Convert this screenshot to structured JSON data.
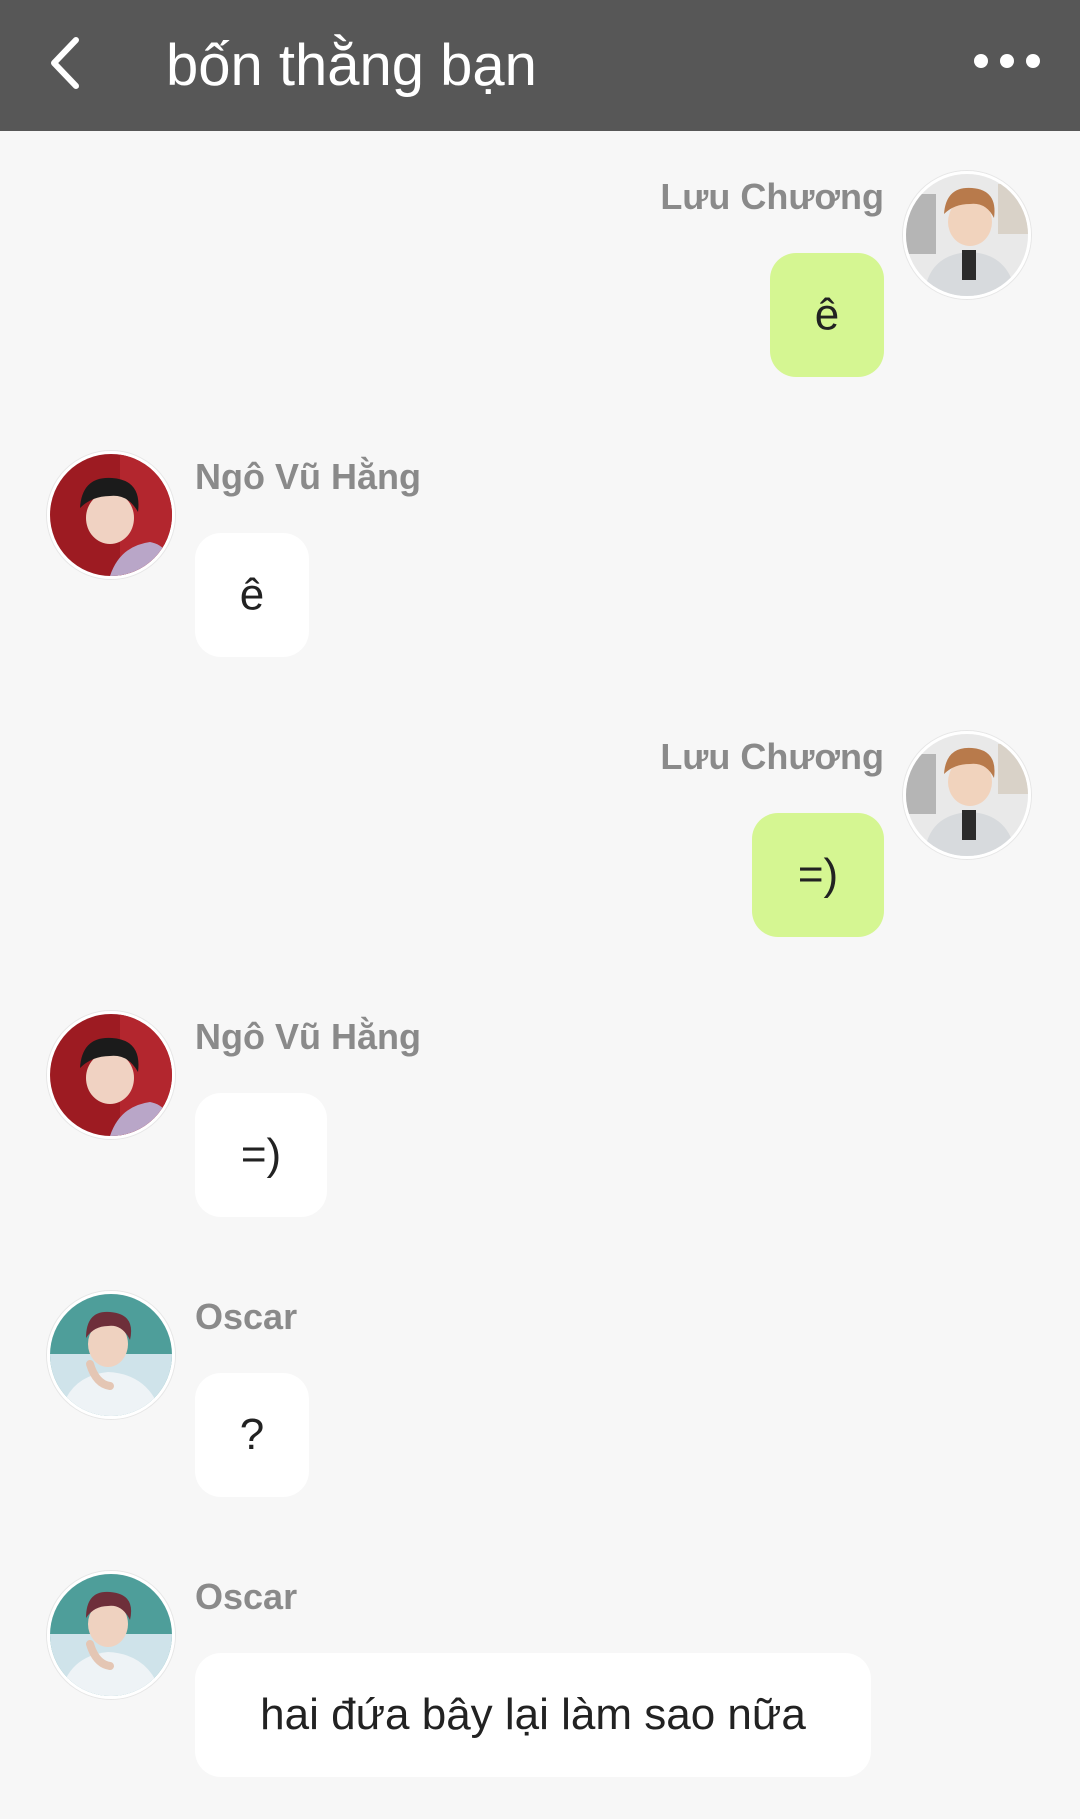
{
  "header": {
    "title": "bốn thằng bạn",
    "back_icon": "chevron-left-icon",
    "more_icon": "more-horizontal-icon",
    "background": "#575757"
  },
  "colors": {
    "outgoing_bubble": "#d5f692",
    "incoming_bubble": "#ffffff",
    "chat_background": "#f7f7f7",
    "sender_name": "#8a8a8a"
  },
  "messages": [
    {
      "sender": "Lưu Chương",
      "text": "ê",
      "direction": "outgoing"
    },
    {
      "sender": "Ngô Vũ Hằng",
      "text": "ê",
      "direction": "incoming"
    },
    {
      "sender": "Lưu Chương",
      "text": "=)",
      "direction": "outgoing"
    },
    {
      "sender": "Ngô Vũ Hằng",
      "text": "=)",
      "direction": "incoming"
    },
    {
      "sender": "Oscar",
      "text": "?",
      "direction": "incoming"
    },
    {
      "sender": "Oscar",
      "text": "hai đứa bây lại làm sao nữa",
      "direction": "incoming"
    }
  ]
}
